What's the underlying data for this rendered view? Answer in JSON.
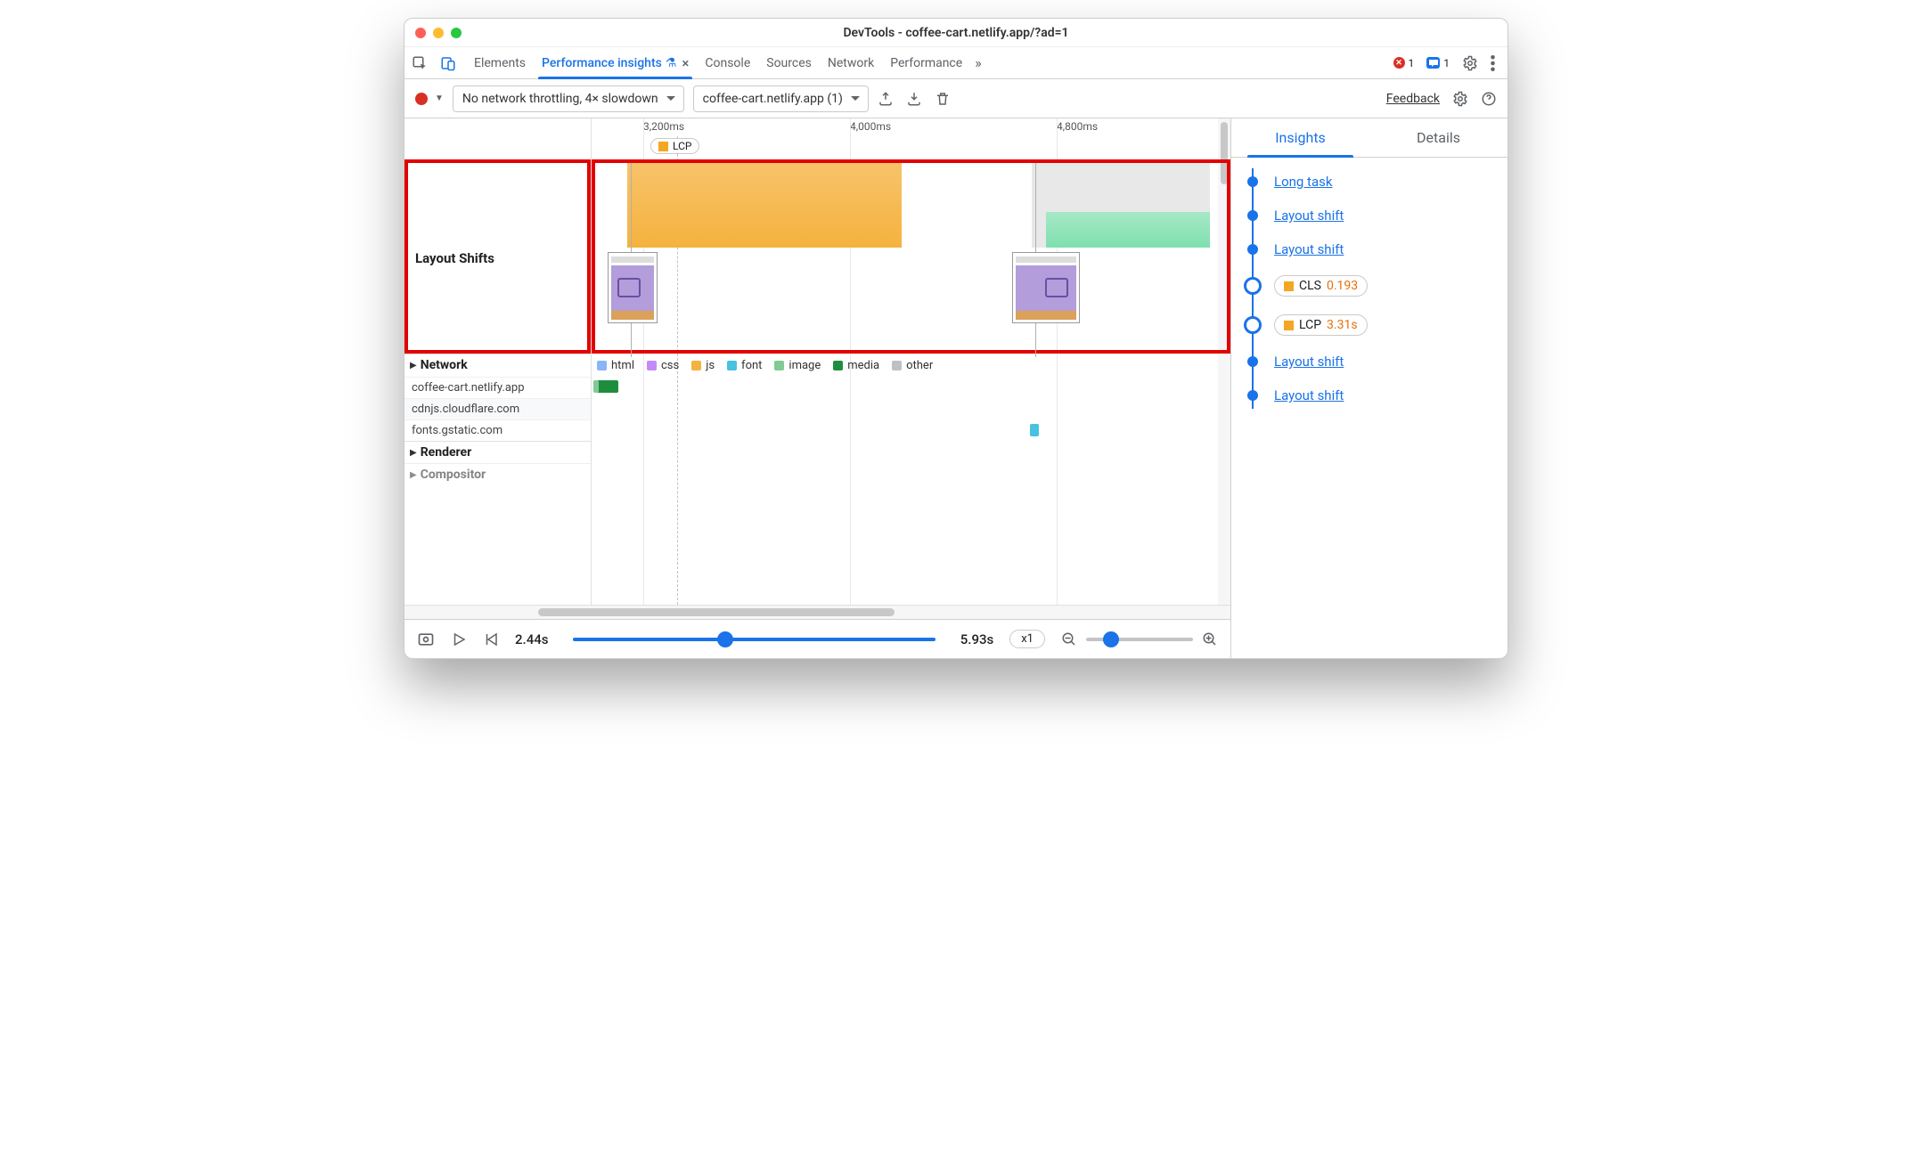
{
  "window": {
    "title": "DevTools - coffee-cart.netlify.app/?ad=1"
  },
  "tabs": {
    "elements": "Elements",
    "perf_insights": "Performance insights",
    "console": "Console",
    "sources": "Sources",
    "network": "Network",
    "performance": "Performance"
  },
  "counts": {
    "errors": "1",
    "messages": "1"
  },
  "toolbar": {
    "throttling": "No network throttling, 4× slowdown",
    "session": "coffee-cart.netlify.app (1)",
    "feedback": "Feedback"
  },
  "timeline": {
    "ticks": [
      "3,200ms",
      "4,000ms",
      "4,800ms"
    ],
    "lcp_badge": "LCP",
    "layout_shifts_label": "Layout Shifts"
  },
  "legend": {
    "html": "html",
    "css": "css",
    "js": "js",
    "font": "font",
    "image": "image",
    "media": "media",
    "other": "other"
  },
  "sections": {
    "network": "Network",
    "renderer": "Renderer",
    "compositor": "Compositor"
  },
  "net_hosts": [
    "coffee-cart.netlify.app",
    "cdnjs.cloudflare.com",
    "fonts.gstatic.com"
  ],
  "right": {
    "tab_insights": "Insights",
    "tab_details": "Details",
    "items": [
      {
        "type": "link",
        "label": "Long task"
      },
      {
        "type": "link",
        "label": "Layout shift"
      },
      {
        "type": "link",
        "label": "Layout shift"
      },
      {
        "type": "metric",
        "name": "CLS",
        "value": "0.193",
        "color": "orange",
        "big": true
      },
      {
        "type": "metric",
        "name": "LCP",
        "value": "3.31s",
        "color": "orange",
        "big": true
      },
      {
        "type": "link",
        "label": "Layout shift"
      },
      {
        "type": "link",
        "label": "Layout shift"
      }
    ]
  },
  "playback": {
    "start": "2.44s",
    "end": "5.93s",
    "speed": "x1"
  }
}
